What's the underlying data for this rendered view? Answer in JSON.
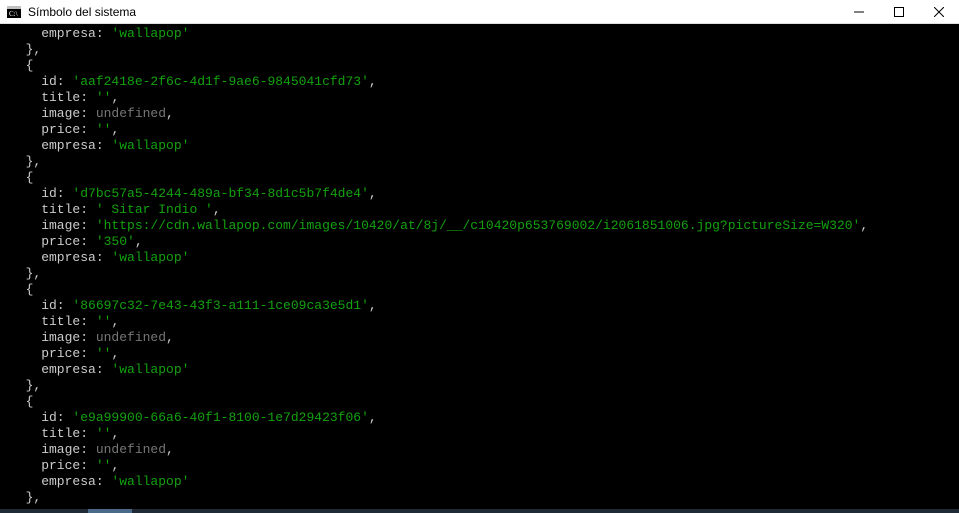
{
  "window": {
    "title": "Símbolo del sistema"
  },
  "objects": [
    {
      "lead": "    empresa: ",
      "fields": [
        {
          "key": "empresa",
          "value": "'wallapop'",
          "cls": "s"
        }
      ],
      "partial_head": true
    },
    {
      "fields": [
        {
          "key": "id",
          "value": "'aaf2418e-2f6c-4d1f-9ae6-9845041cfd73'",
          "cls": "s"
        },
        {
          "key": "title",
          "value": "''",
          "cls": "s"
        },
        {
          "key": "image",
          "value": "undefined",
          "cls": "u"
        },
        {
          "key": "price",
          "value": "''",
          "cls": "s"
        },
        {
          "key": "empresa",
          "value": "'wallapop'",
          "cls": "s"
        }
      ]
    },
    {
      "fields": [
        {
          "key": "id",
          "value": "'d7bc57a5-4244-489a-bf34-8d1c5b7f4de4'",
          "cls": "s"
        },
        {
          "key": "title",
          "value": "' Sitar Indio '",
          "cls": "s"
        },
        {
          "key": "image",
          "value": "'https://cdn.wallapop.com/images/10420/at/8j/__/c10420p653769002/i2061851006.jpg?pictureSize=W320'",
          "cls": "s"
        },
        {
          "key": "price",
          "value": "'350'",
          "cls": "s"
        },
        {
          "key": "empresa",
          "value": "'wallapop'",
          "cls": "s"
        }
      ]
    },
    {
      "fields": [
        {
          "key": "id",
          "value": "'86697c32-7e43-43f3-a111-1ce09ca3e5d1'",
          "cls": "s"
        },
        {
          "key": "title",
          "value": "''",
          "cls": "s"
        },
        {
          "key": "image",
          "value": "undefined",
          "cls": "u"
        },
        {
          "key": "price",
          "value": "''",
          "cls": "s"
        },
        {
          "key": "empresa",
          "value": "'wallapop'",
          "cls": "s"
        }
      ]
    },
    {
      "fields": [
        {
          "key": "id",
          "value": "'e9a99900-66a6-40f1-8100-1e7d29423f06'",
          "cls": "s"
        },
        {
          "key": "title",
          "value": "''",
          "cls": "s"
        },
        {
          "key": "image",
          "value": "undefined",
          "cls": "u"
        },
        {
          "key": "price",
          "value": "''",
          "cls": "s"
        },
        {
          "key": "empresa",
          "value": "'wallapop'",
          "cls": "s"
        }
      ]
    }
  ]
}
